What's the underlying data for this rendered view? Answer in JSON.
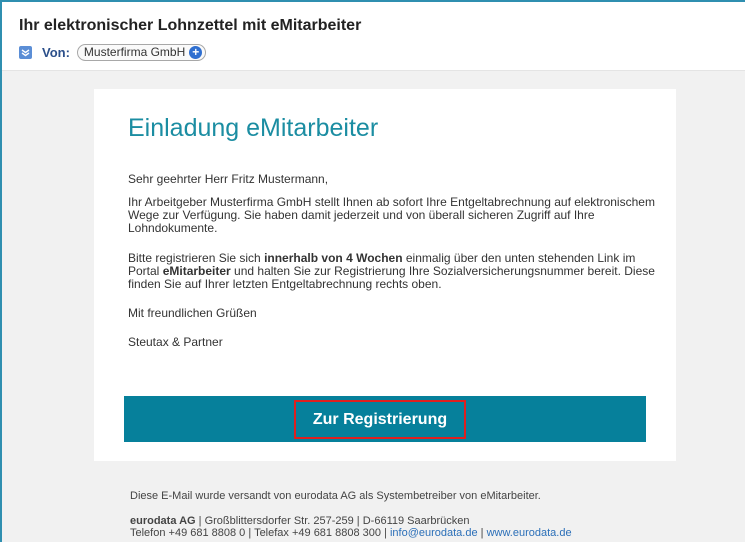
{
  "email": {
    "subject": "Ihr elektronischer Lohnzettel mit eMitarbeiter",
    "from_label": "Von:",
    "sender": "Musterfirma GmbH",
    "sender_add_icon": "plus-circle-icon",
    "header_icon": "collapse-chevron-icon"
  },
  "card": {
    "title": "Einladung eMitarbeiter",
    "salutation": "Sehr geehrter Herr Fritz Mustermann,",
    "paragraph1": "Ihr Arbeitgeber Musterfirma GmbH stellt Ihnen ab sofort Ihre Entgeltabrechnung auf elektronischem Wege zur Verfügung. Sie haben damit jederzeit und von überall sicheren Zugriff auf Ihre Lohndokumente.",
    "paragraph2_part1": "Bitte registrieren Sie sich ",
    "paragraph2_bold1": "innerhalb von 4 Wochen",
    "paragraph2_part2": " einmalig über den unten stehenden Link im Portal ",
    "paragraph2_bold2": "eMitarbeiter",
    "paragraph2_part3": " und halten Sie zur Registrierung Ihre Sozialversicherungsnummer bereit. Diese finden Sie auf Ihrer letzten Entgeltabrechnung rechts oben.",
    "closing": "Mit freundlichen Grüßen",
    "signature": "Steutax & Partner",
    "cta_label": "Zur Registrierung"
  },
  "footer": {
    "notice": "Diese E-Mail wurde versandt von eurodata AG als Systembetreiber von eMitarbeiter.",
    "company": "eurodata AG",
    "address": " | Großblittersdorfer Str. 257-259 | D-66119 Saarbrücken",
    "contact_prefix": "Telefon +49 681 8808 0 | Telefax +49 681 8808 300 | ",
    "email": "info@eurodata.de",
    "separator": " | ",
    "website": "www.eurodata.de"
  },
  "colors": {
    "accent": "#1b8da2",
    "cta_background": "#06809b",
    "highlight_border": "#e0201f",
    "frame": "#2f8fb0"
  }
}
